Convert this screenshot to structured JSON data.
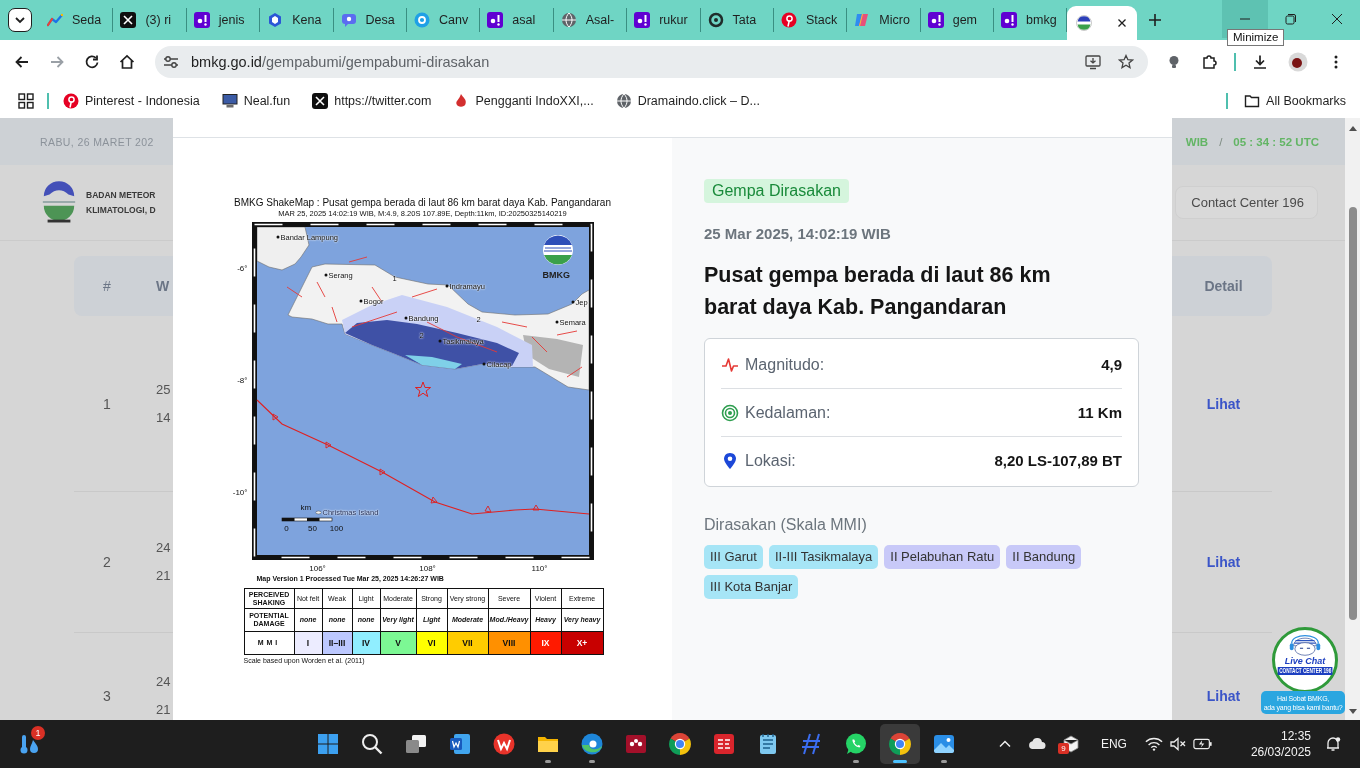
{
  "browser": {
    "tabs": [
      {
        "title": "Seda",
        "kind": "chart",
        "selected": false
      },
      {
        "title": "(3) ri",
        "kind": "x",
        "selected": false
      },
      {
        "title": "jenis",
        "kind": "yahoo",
        "selected": false
      },
      {
        "title": "Kena",
        "kind": "hexagon",
        "selected": false
      },
      {
        "title": "Desa",
        "kind": "chat",
        "selected": false
      },
      {
        "title": "Canv",
        "kind": "canva",
        "selected": false
      },
      {
        "title": "asal",
        "kind": "yahoo",
        "selected": false
      },
      {
        "title": "Asal-",
        "kind": "globe",
        "selected": false
      },
      {
        "title": "rukur",
        "kind": "yahoo",
        "selected": false
      },
      {
        "title": "Tata",
        "kind": "ring",
        "selected": false
      },
      {
        "title": "Stack",
        "kind": "pinterest",
        "selected": false
      },
      {
        "title": "Micro",
        "kind": "copilot",
        "selected": false
      },
      {
        "title": "gem",
        "kind": "yahoo",
        "selected": false
      },
      {
        "title": "bmkg",
        "kind": "yahoo",
        "selected": false
      },
      {
        "kind": "bmkg",
        "selected": true
      }
    ],
    "window_controls": [
      {
        "kind": "minimize",
        "hovered": true,
        "tooltip": "Minimize"
      },
      {
        "kind": "maximize",
        "hovered": false
      },
      {
        "kind": "close",
        "hovered": false
      }
    ],
    "nav_buttons": [
      {
        "kind": "back",
        "disabled": false
      },
      {
        "kind": "forward",
        "disabled": true
      },
      {
        "kind": "reload",
        "disabled": false
      },
      {
        "kind": "home",
        "disabled": false
      }
    ],
    "address": {
      "domain": "bmkg.go.id",
      "path": "/gempabumi/gempabumi-dirasakan"
    },
    "bookmarks": [
      {
        "label": "Pinterest - Indonesia",
        "kind": "pinterest"
      },
      {
        "label": "Neal.fun",
        "kind": "computer"
      },
      {
        "label": "https://twitter.com",
        "kind": "x"
      },
      {
        "label": "Pengganti IndoXXI,...",
        "kind": "flame"
      },
      {
        "label": "Dramaindo.click – D...",
        "kind": "globe"
      }
    ],
    "all_bookmarks": "All Bookmarks"
  },
  "page": {
    "date": "RABU, 26 MARET 202",
    "clock_zone": "WIB",
    "clock_separator": "/",
    "clock_utc": "05 : 34 : 52 UTC",
    "org_name": [
      "BADAN METEOR",
      "KLIMATOLOGI, D"
    ],
    "contact": "Contact Center 196",
    "table": {
      "columns": [
        "#",
        "W",
        "Detail"
      ],
      "rows": [
        {
          "number": "1",
          "time": [
            "25",
            "14"
          ],
          "action": "Lihat"
        },
        {
          "number": "2",
          "time": [
            "24",
            "21"
          ],
          "action": "Lihat"
        },
        {
          "number": "3",
          "time": [
            "24",
            "21"
          ],
          "action": "Lihat"
        }
      ]
    }
  },
  "modal": {
    "shakemap": {
      "title": "BMKG ShakeMap : Pusat gempa berada di laut 86 km barat daya Kab. Pangandaran",
      "subtitle": "MAR 25, 2025 14:02:19 WIB, M:4.9, 8.20S 107.89E, Depth:11km, ID:20250325140219",
      "lat_ticks": [
        "-6°",
        "-8°",
        "-10°"
      ],
      "lon_ticks": [
        "106°",
        "108°",
        "110°"
      ],
      "places": [
        {
          "name": "Bandar Lampung",
          "kind": "city"
        },
        {
          "name": "Serang",
          "kind": "city"
        },
        {
          "name": "Bogor",
          "kind": "city"
        },
        {
          "name": "Indramayu",
          "kind": "city"
        },
        {
          "name": "Bandung",
          "kind": "city"
        },
        {
          "name": "Tasikmalaya",
          "kind": "city"
        },
        {
          "name": "Cilacap",
          "kind": "city"
        },
        {
          "name": "Jep",
          "kind": "city"
        },
        {
          "name": "Semara",
          "kind": "city"
        },
        {
          "name": "1",
          "kind": "contour"
        },
        {
          "name": "2",
          "kind": "contour"
        },
        {
          "name": "2",
          "kind": "contour"
        },
        {
          "name": "Christmas Island",
          "kind": "island"
        }
      ],
      "logo_text": "BMKG",
      "scale_unit": "km",
      "scale_ticks": [
        "0",
        "50",
        "100"
      ],
      "version": "Map Version 1 Processed Tue Mar 25, 2025 14:26:27 WIB",
      "legend": {
        "row_labels": [
          "PERCEIVED SHAKING",
          "POTENTIAL DAMAGE",
          "MMI"
        ],
        "levels": [
          {
            "shaking": "Not felt",
            "damage": "none",
            "mmi": "I",
            "color": "#ececff"
          },
          {
            "shaking": "Weak",
            "damage": "none",
            "mmi": "II–III",
            "color": "#bcc8ff"
          },
          {
            "shaking": "Light",
            "damage": "none",
            "mmi": "IV",
            "color": "#90eeff"
          },
          {
            "shaking": "Moderate",
            "damage": "Very light",
            "mmi": "V",
            "color": "#7cf894"
          },
          {
            "shaking": "Strong",
            "damage": "Light",
            "mmi": "VI",
            "color": "#ffff00"
          },
          {
            "shaking": "Very strong",
            "damage": "Moderate",
            "mmi": "VII",
            "color": "#ffcc00"
          },
          {
            "shaking": "Severe",
            "damage": "Mod./Heavy",
            "mmi": "VIII",
            "color": "#ff9000"
          },
          {
            "shaking": "Violent",
            "damage": "Heavy",
            "mmi": "IX",
            "color": "#ff1a00"
          },
          {
            "shaking": "Extreme",
            "damage": "Very heavy",
            "mmi": "X+",
            "color": "#c80000"
          }
        ]
      },
      "footnote": "Scale based upon Worden et al. (2011)"
    },
    "badge": "Gempa Dirasakan",
    "datetime": "25 Mar 2025, 14:02:19 WIB",
    "headline": "Pusat gempa berada di laut 86 km barat daya Kab. Pangandaran",
    "details": [
      {
        "kind": "magnitude",
        "label": "Magnitudo:",
        "value": "4,9"
      },
      {
        "kind": "depth",
        "label": "Kedalaman:",
        "value": "11 Km"
      },
      {
        "kind": "location",
        "label": "Lokasi:",
        "value": "8,20 LS-107,89 BT"
      }
    ],
    "felt_heading": "Dirasakan (Skala MMI)",
    "felt": [
      {
        "label": "III Garut",
        "color": "#a6e5f6"
      },
      {
        "label": "II-III Tasikmalaya",
        "color": "#a6e5f6"
      },
      {
        "label": "II Pelabuhan Ratu",
        "color": "#c8c9f8"
      },
      {
        "label": "II Bandung",
        "color": "#c8c9f8"
      },
      {
        "label": "III Kota Banjar",
        "color": "#a6e5f6"
      }
    ]
  },
  "live_chat": {
    "title": "Live Chat",
    "subtitle": "CONTACT CENTER 196",
    "bubble": [
      "Hai Sobat BMKG,",
      "ada yang bisa kami bantu?"
    ]
  },
  "taskbar": {
    "widget_badge": "1",
    "apps": [
      {
        "kind": "start",
        "running": false,
        "selected": false
      },
      {
        "kind": "search",
        "running": false,
        "selected": false
      },
      {
        "kind": "taskview",
        "running": false,
        "selected": false
      },
      {
        "kind": "word",
        "running": false,
        "selected": false
      },
      {
        "kind": "wps",
        "running": false,
        "selected": false
      },
      {
        "kind": "explorer",
        "running": true,
        "selected": false
      },
      {
        "kind": "edge",
        "running": true,
        "selected": false
      },
      {
        "kind": "mendeley",
        "running": false,
        "selected": false
      },
      {
        "kind": "chrome",
        "running": false,
        "selected": false
      },
      {
        "kind": "se",
        "running": false,
        "selected": false
      },
      {
        "kind": "notepad",
        "running": false,
        "selected": false
      },
      {
        "kind": "slash",
        "running": false,
        "selected": false
      },
      {
        "kind": "whatsapp",
        "running": true,
        "selected": false
      },
      {
        "kind": "chrome",
        "running": true,
        "selected": true
      },
      {
        "kind": "photos",
        "running": true,
        "selected": false
      }
    ],
    "tray_badge": "9",
    "language": "ENG",
    "muted": true,
    "time": "12:35",
    "date": "26/03/2025"
  }
}
